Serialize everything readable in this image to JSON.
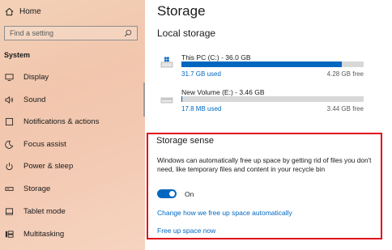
{
  "sidebar": {
    "home_label": "Home",
    "search_placeholder": "Find a setting",
    "section_label": "System",
    "items": [
      {
        "label": "Display",
        "icon": "display-icon"
      },
      {
        "label": "Sound",
        "icon": "speaker-icon"
      },
      {
        "label": "Notifications & actions",
        "icon": "notification-icon"
      },
      {
        "label": "Focus assist",
        "icon": "moon-icon"
      },
      {
        "label": "Power & sleep",
        "icon": "power-icon"
      },
      {
        "label": "Storage",
        "icon": "storage-icon"
      },
      {
        "label": "Tablet mode",
        "icon": "tablet-icon"
      },
      {
        "label": "Multitasking",
        "icon": "multitasking-icon"
      }
    ]
  },
  "main": {
    "title": "Storage",
    "local_storage_heading": "Local storage",
    "drives": [
      {
        "name": "This PC (C:) - 36.0 GB",
        "used": "31.7 GB used",
        "free": "4.28 GB free",
        "fill_fraction": 0.88
      },
      {
        "name": "New Volume (E:) - 3.46 GB",
        "used": "17.8 MB used",
        "free": "3.44 GB free",
        "fill_fraction": 0.005
      }
    ],
    "storage_sense": {
      "heading": "Storage sense",
      "description": "Windows can automatically free up space by getting rid of files you don't need, like temporary files and content in your recycle bin",
      "toggle_label": "On",
      "toggle_on": true,
      "link_change": "Change how we free up space automatically",
      "link_free_now": "Free up space now"
    }
  },
  "colors": {
    "accent": "#0067c0",
    "highlight_border": "#e0101a",
    "bar_track": "#d8d8d8"
  }
}
